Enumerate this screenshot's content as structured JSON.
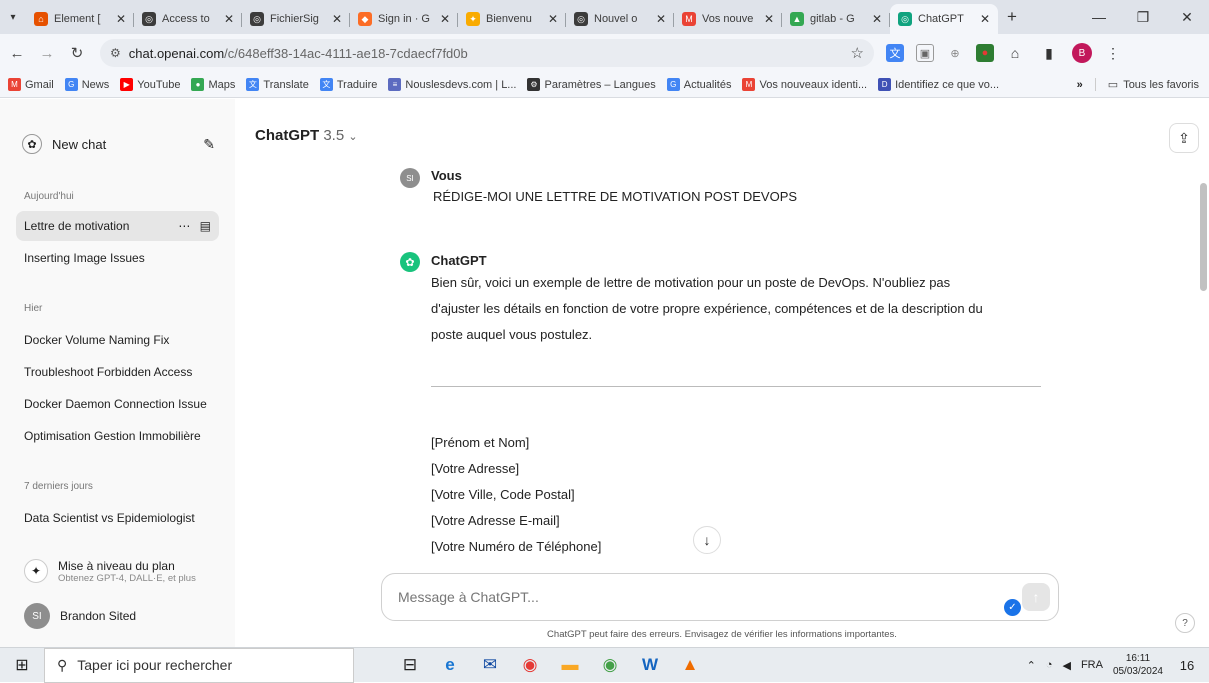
{
  "browser": {
    "tabs": [
      {
        "label": "Element [",
        "color": "#e65100",
        "glyph": "⌂",
        "active": false
      },
      {
        "label": "Access to",
        "color": "#3c3c3c",
        "glyph": "◎",
        "active": false
      },
      {
        "label": "FichierSig",
        "color": "#3c3c3c",
        "glyph": "◎",
        "active": false
      },
      {
        "label": "Sign in · G",
        "color": "#fc6d26",
        "glyph": "◆",
        "active": false
      },
      {
        "label": "Bienvenu",
        "color": "#f9ab00",
        "glyph": "✦",
        "active": false
      },
      {
        "label": "Nouvel o",
        "color": "#3c3c3c",
        "glyph": "◎",
        "active": false
      },
      {
        "label": "Vos nouve",
        "color": "#ea4335",
        "glyph": "M",
        "active": false
      },
      {
        "label": "gitlab - G",
        "color": "#34a853",
        "glyph": "▲",
        "active": false
      },
      {
        "label": "ChatGPT",
        "color": "#10a37f",
        "glyph": "◎",
        "active": true
      }
    ],
    "new_tab_symbol": "+",
    "window_controls": [
      "—",
      "❐",
      "✕"
    ],
    "url_host": "chat.openai.com",
    "url_path": "/c/648eff38-14ac-4111-ae18-7cdaecf7fd0b",
    "profile_initial": "B",
    "bookmarks": [
      {
        "label": "Gmail",
        "color": "#ea4335",
        "glyph": "M"
      },
      {
        "label": "News",
        "color": "#4285f4",
        "glyph": "G"
      },
      {
        "label": "YouTube",
        "color": "#ff0000",
        "glyph": "▶"
      },
      {
        "label": "Maps",
        "color": "#34a853",
        "glyph": "●"
      },
      {
        "label": "Translate",
        "color": "#4285f4",
        "glyph": "文"
      },
      {
        "label": "Traduire",
        "color": "#4285f4",
        "glyph": "文"
      },
      {
        "label": "Nouslesdevs.com | L...",
        "color": "#5c6bc0",
        "glyph": "≡"
      },
      {
        "label": "Paramètres – Langues",
        "color": "#333333",
        "glyph": "⚙"
      },
      {
        "label": "Actualités",
        "color": "#4285f4",
        "glyph": "G"
      },
      {
        "label": "Vos nouveaux identi...",
        "color": "#ea4335",
        "glyph": "M"
      },
      {
        "label": "Identifiez ce que vo...",
        "color": "#3f51b5",
        "glyph": "D"
      }
    ],
    "bookmarks_more": "»",
    "all_bookmarks": "Tous les favoris"
  },
  "sidebar": {
    "new_chat": "New chat",
    "sections": [
      {
        "title": "Aujourd'hui",
        "items": [
          "Lettre de motivation",
          "Inserting Image Issues"
        ]
      },
      {
        "title": "Hier",
        "items": [
          "Docker Volume Naming Fix",
          "Troubleshoot Forbidden Access",
          "Docker Daemon Connection Issue",
          "Optimisation Gestion Immobilière"
        ]
      },
      {
        "title": "7 derniers jours",
        "items": [
          "Data Scientist vs Epidemiologist"
        ]
      }
    ],
    "upgrade_title": "Mise à niveau du plan",
    "upgrade_subtitle": "Obtenez GPT-4, DALL·E, et plus",
    "user_initials": "SI",
    "user_name": "Brandon Sited"
  },
  "chat": {
    "model_name": "ChatGPT",
    "model_version": "3.5",
    "user_author": "Vous",
    "user_avatar": "SI",
    "user_message": "RÉDIGE-MOI UNE  LETTRE DE MOTIVATION POST DEVOPS",
    "assistant_author": "ChatGPT",
    "assistant_intro": [
      "Bien sûr, voici un exemple de lettre de motivation pour un poste de DevOps. N'oubliez pas",
      "d'ajuster les détails en fonction de votre propre expérience, compétences et de la description du",
      "poste auquel vous postulez."
    ],
    "letter_lines": [
      "[Prénom et Nom]",
      "[Votre Adresse]",
      "[Votre Ville, Code Postal]",
      "[Votre Adresse E-mail]",
      "[Votre Numéro de Téléphone]"
    ],
    "input_placeholder": "Message à ChatGPT...",
    "disclaimer": "ChatGPT peut faire des erreurs. Envisagez de vérifier les informations importantes.",
    "help": "?"
  },
  "taskbar": {
    "search_placeholder": "Taper ici pour rechercher",
    "language": "FRA",
    "time": "16:11",
    "date": "05/03/2024",
    "notifications": "16"
  }
}
